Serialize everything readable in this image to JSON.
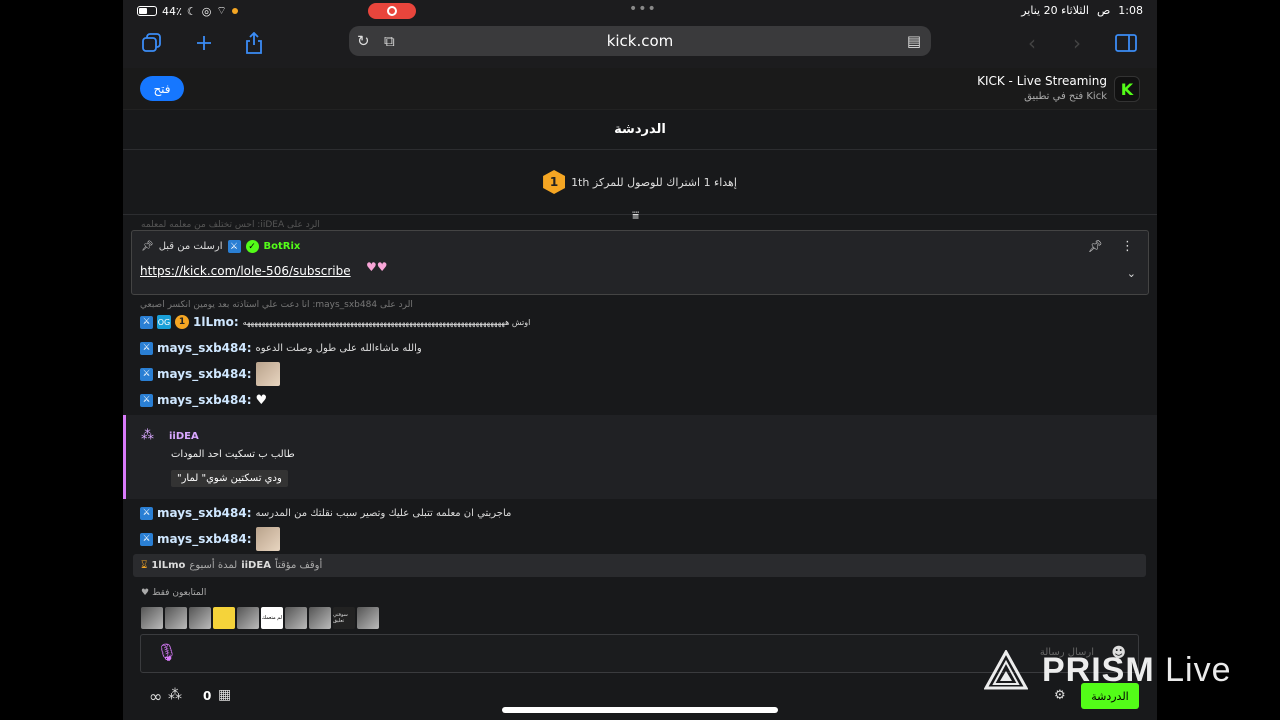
{
  "status": {
    "battery": "44٪",
    "time": "1:08",
    "period": "ص",
    "date": "الثلاثاء 20 يناير"
  },
  "safari": {
    "url": "kick.com",
    "icons": [
      "tabs-icon",
      "new-tab-icon",
      "share-icon",
      "reload-icon",
      "extensions-icon",
      "reader-icon",
      "back-icon",
      "forward-icon",
      "sidebar-icon"
    ]
  },
  "banner": {
    "open_label": "فتح",
    "app_title": "KICK - Live Streaming",
    "app_subtitle": "فتح في تطبيق Kick"
  },
  "chat": {
    "title": "الدردشة",
    "goal_badge": "1",
    "goal_text": "إهداء 1 اشتراك للوصول للمركز 1th",
    "faded_reply": "الرد على iiDEA: احس تختلف من معلمه لمعلمه",
    "pinned": {
      "sent_by_label": "ارسلت من قبل",
      "bot_name": "BotRix",
      "link": "https://kick.com/lole-506/subscribe"
    },
    "reply_hint": "الرد على mays_sxb484: انا دعت علي استاذته بعد يومين انكسر اصبعي",
    "messages": [
      {
        "user": "1lLmo:",
        "gift": "1",
        "text": "اوتش هههههههههههههههههههههههههههههههههههههههههههههههههههههههههههههههههههههههه"
      },
      {
        "user": "mays_sxb484:",
        "text": "والله ماشاءالله على طول وصلت الدعوه"
      },
      {
        "user": "mays_sxb484:",
        "text": ""
      },
      {
        "user": "mays_sxb484:",
        "text": ""
      }
    ],
    "highlight": {
      "user": "iiDEA",
      "text": "طالب ب تسكيت احد المودات",
      "quote": "ودي تسكتين شوي\" لمار\""
    },
    "messages2": [
      {
        "user": "mays_sxb484:",
        "text": "ماجربتي ان معلمه تتبلى عليك وتصير سبب نقلتك من المدرسه"
      },
      {
        "user": "mays_sxb484:",
        "text": ""
      }
    ],
    "timeout": {
      "prefix": "أوقف مؤقتاً",
      "moderator": "iiDEA",
      "duration": "لمدة أسبوع",
      "target": "1lLmo"
    },
    "followers_only": "المتابعون فقط",
    "emote_labels": [
      "",
      "",
      "",
      "",
      "",
      "لم متعمك",
      "",
      "",
      "سوفتي تعليق",
      ""
    ],
    "input_placeholder": "ارسال رسالة",
    "count": "0",
    "send_label": "الدردشة"
  },
  "watermark": {
    "brand": "PRISM",
    "suffix": "Live"
  }
}
